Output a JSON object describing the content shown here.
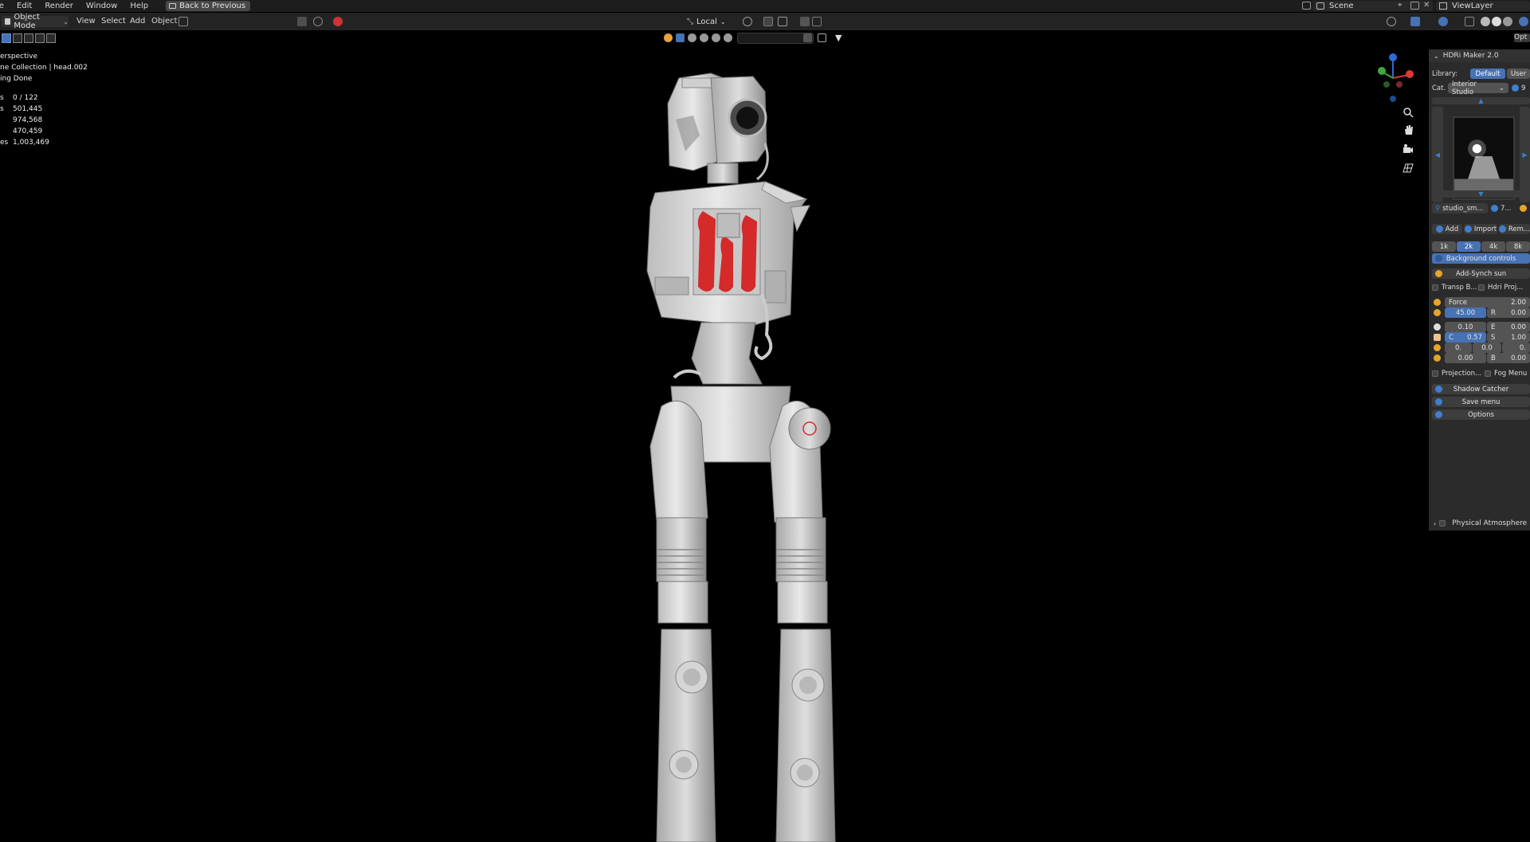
{
  "topbar": {
    "menu": [
      "le",
      "Edit",
      "Render",
      "Window",
      "Help"
    ],
    "back_button": "Back to Previous",
    "scene": "Scene",
    "view_layer": "ViewLayer"
  },
  "header": {
    "mode": "Object Mode",
    "menu": [
      "View",
      "Select",
      "Add",
      "Object"
    ],
    "transform_orientation": "Local",
    "options_label": "Opt"
  },
  "overlay": {
    "view": "erspective",
    "collection": "ne Collection | head.002",
    "status": "ing Done",
    "stats": [
      {
        "label": "s",
        "value": "0 / 122"
      },
      {
        "label": "s",
        "value": "501,445"
      },
      {
        "label": "",
        "value": "974,568"
      },
      {
        "label": "",
        "value": "470,459"
      },
      {
        "label": "es",
        "value": "1,003,469"
      }
    ]
  },
  "panel": {
    "title": "HDRi Maker 2.0",
    "library_label": "Library:",
    "library_default": "Default",
    "library_user": "User",
    "category_label": "Cat.",
    "category_value": "Interior Studio",
    "category_extra": "9",
    "hdri_name": "studio_sm...",
    "hdri_count": "7...",
    "add": "Add",
    "import": "Import",
    "remove": "Rem...",
    "resolutions": [
      "1k",
      "2k",
      "4k",
      "8k"
    ],
    "active_resolution": "2k",
    "background_controls": "Background controls",
    "add_synch_sun": "Add-Synch sun",
    "transp_b": "Transp B...",
    "hdri_proj": "Hdri Proj...",
    "force_label": "Force",
    "force_value": "2.00",
    "rot_value": "45.00",
    "r_label": "R",
    "r_value": "0.00",
    "row3_left": "0.10",
    "e_label": "E",
    "e_value": "0.00",
    "c_label": "C",
    "c_value": "0.57",
    "s_label": "S",
    "s_value": "1.00",
    "row5_a": "0.",
    "row5_b": "0.0",
    "row5_c": "0.",
    "row6_left": "0.00",
    "b_label": "B",
    "b_value": "0.00",
    "projection": "Projection...",
    "fog_menu": "Fog Menu",
    "shadow_catcher": "Shadow Catcher",
    "save_menu": "Save menu",
    "options": "Options",
    "physical_atmosphere": "Physical Atmosphere"
  },
  "colors": {
    "accent": "#4772b3",
    "panel_bg": "#2b2b2b",
    "header_bg": "#232323",
    "highlight_red": "#d42a2a"
  }
}
